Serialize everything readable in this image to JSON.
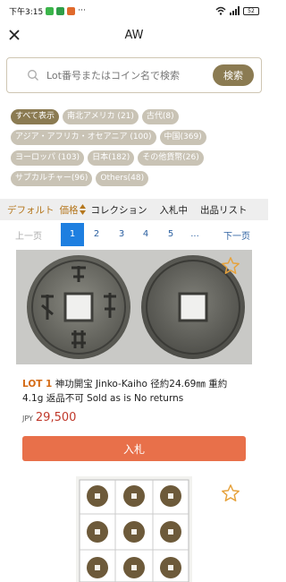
{
  "status": {
    "time": "下午3:15",
    "dots": "···",
    "battery": "52"
  },
  "header": {
    "title": "AW"
  },
  "search": {
    "placeholder": "Lot番号またはコイン名で検索",
    "button": "検索"
  },
  "chips": [
    "すべて表示",
    "南北アメリカ (21)",
    "古代(8)",
    "アジア・アフリカ・オセアニア (100)",
    "中国(369)",
    "ヨーロッパ (103)",
    "日本(182)",
    "その他貨幣(26)",
    "サブカルチャー(96)",
    "Others(48)"
  ],
  "sort": {
    "default": "デフォルト",
    "price": "価格",
    "collection": "コレクション",
    "bidding": "入札中",
    "listing": "出品リスト"
  },
  "pager": {
    "prev": "上一页",
    "pages": [
      "1",
      "2",
      "3",
      "4",
      "5",
      "..."
    ],
    "current": "1",
    "next": "下一页"
  },
  "lot": {
    "number": "LOT 1",
    "description": "神功開宝 Jinko-Kaiho 径約24.69㎜ 重約4.1g 返品不可 Sold as is No returns",
    "currency": "JPY",
    "price": "29,500",
    "bid_button": "入札"
  },
  "colors": {
    "accent": "#8b7b52",
    "chip": "#c9c3b5",
    "bid": "#e8704a",
    "price": "#c0392b",
    "pager_active": "#1e7fe0",
    "lot_no": "#d46a14"
  },
  "icons": [
    "close-icon",
    "search-icon",
    "sort-arrows-icon",
    "star-icon"
  ]
}
